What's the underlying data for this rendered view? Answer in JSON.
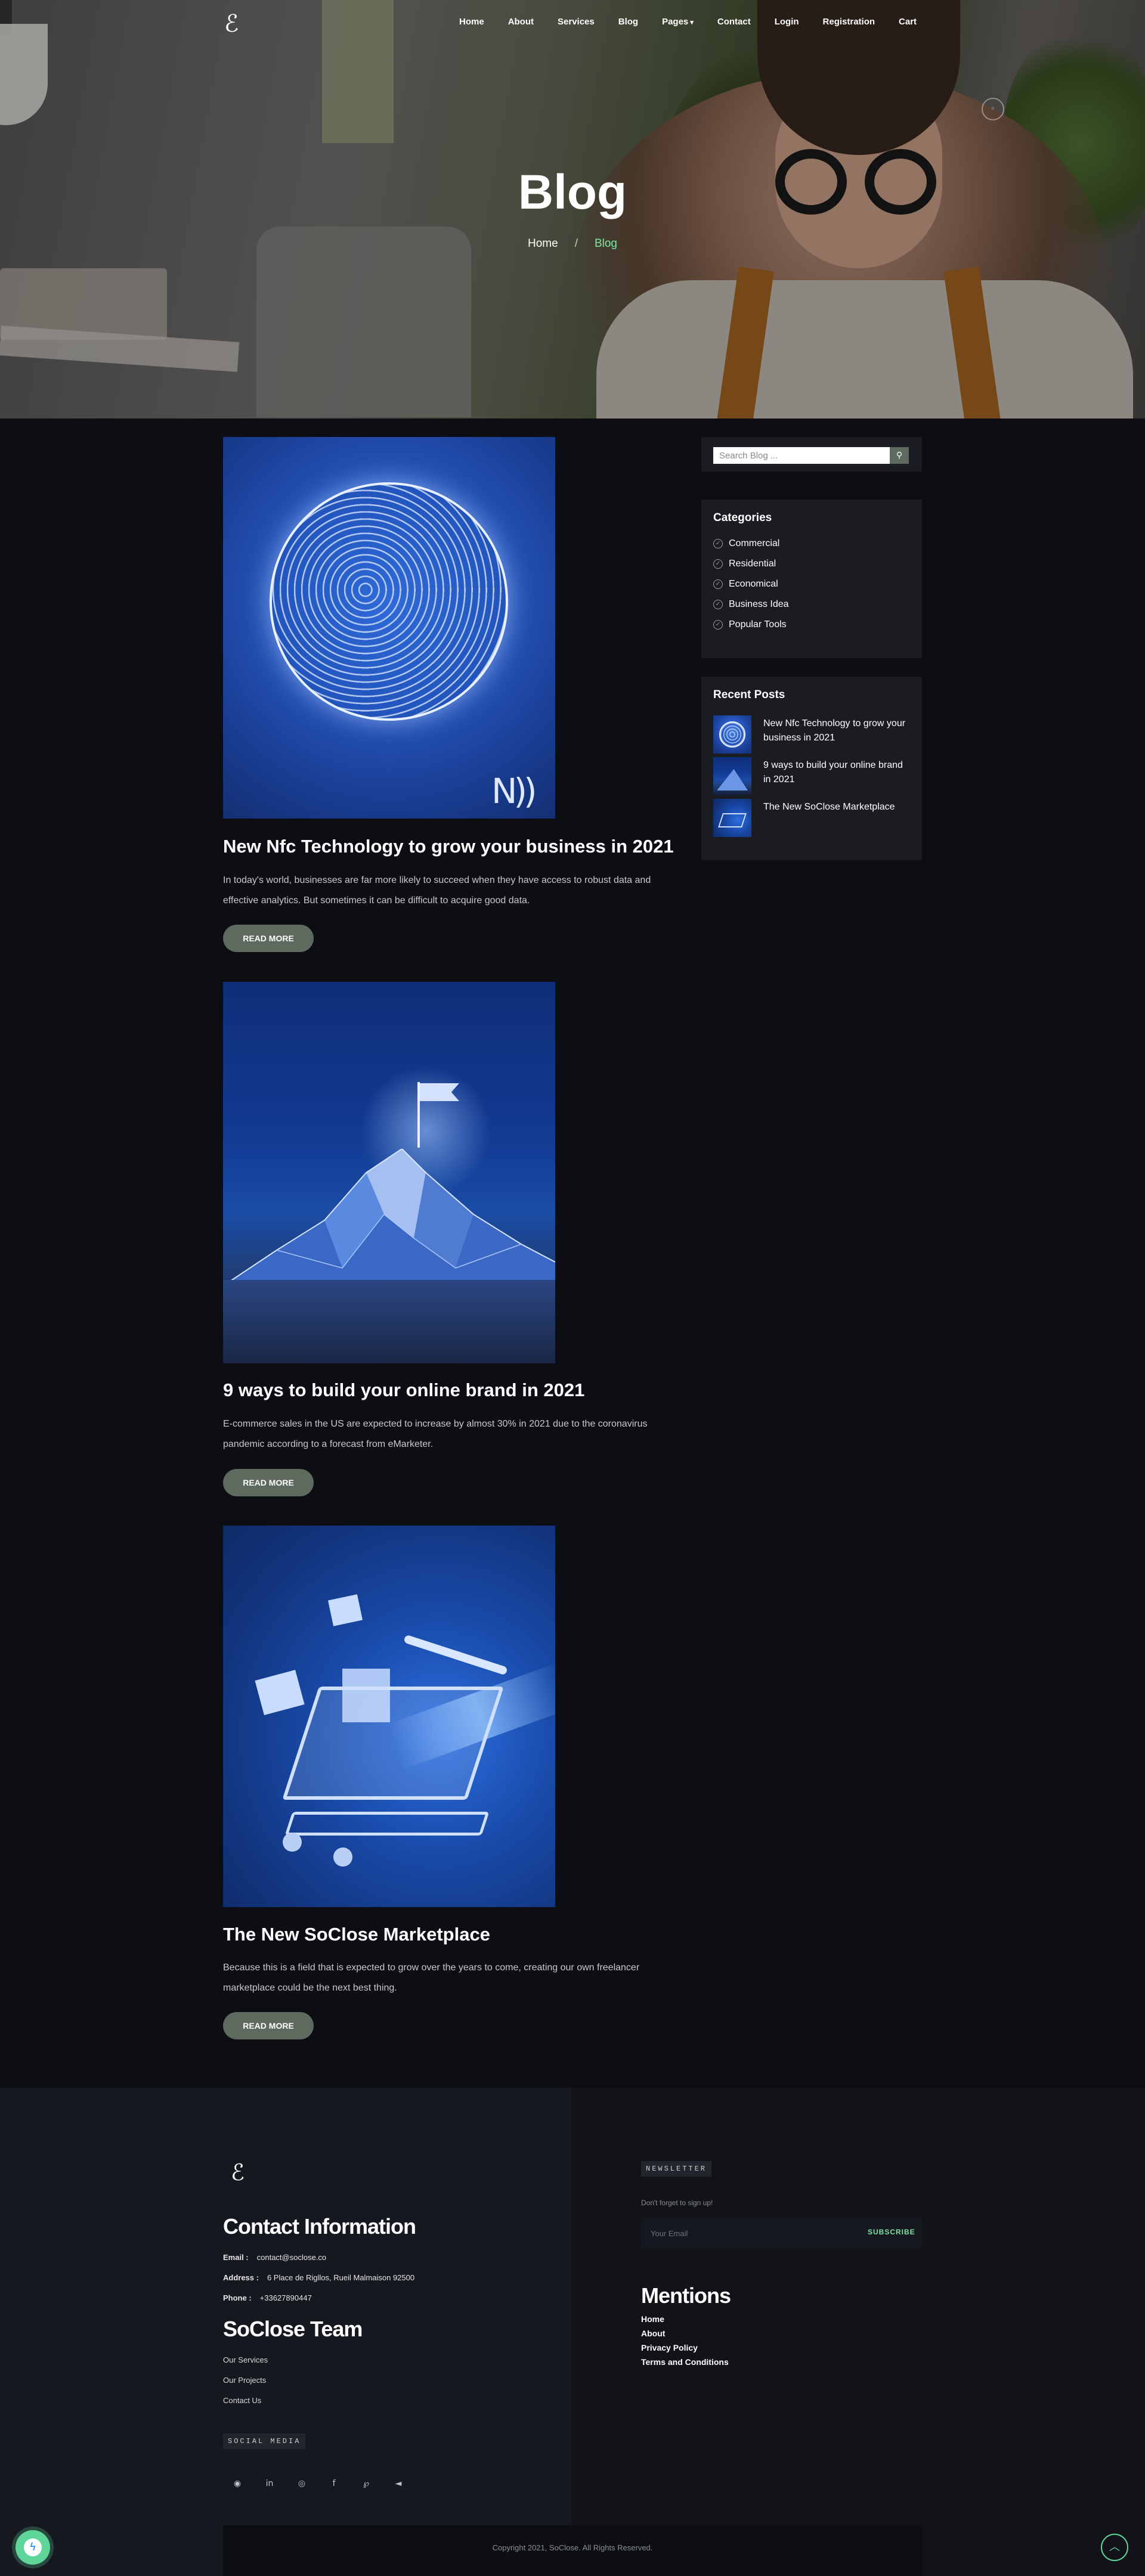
{
  "brand": {
    "logo_glyph": "ℰ"
  },
  "nav": {
    "items": [
      "Home",
      "About",
      "Services",
      "Blog",
      "Pages",
      "Contact",
      "Login",
      "Registration",
      "Cart"
    ]
  },
  "hero": {
    "title": "Blog",
    "breadcrumb": {
      "home": "Home",
      "separator": "/",
      "current": "Blog"
    }
  },
  "posts": [
    {
      "title": "New Nfc Technology to grow your business in 2021",
      "excerpt": "In today's world, businesses are far more likely to succeed when they have access to robust data and effective analytics. But sometimes it can be difficult to acquire good data.",
      "button": "READ MORE"
    },
    {
      "title": "9 ways to build your online brand in 2021",
      "excerpt": "E-commerce sales in the US are expected to increase by almost 30% in 2021 due to the coronavirus pandemic according to a forecast from eMarketer.",
      "button": "READ MORE"
    },
    {
      "title": "The New SoClose Marketplace",
      "excerpt": "Because this is a field that is expected to grow over the years to come, creating our own freelancer marketplace could be the next best thing.",
      "button": "READ MORE"
    }
  ],
  "sidebar": {
    "search_placeholder": "Search Blog ...",
    "categories_title": "Categories",
    "categories": [
      "Commercial",
      "Residential",
      "Economical",
      "Business Idea",
      "Popular Tools"
    ],
    "recent_title": "Recent Posts",
    "recent": [
      "New Nfc Technology to grow your business in 2021",
      "9 ways to build your online brand in 2021",
      "The New SoClose Marketplace"
    ]
  },
  "footer": {
    "contact_title": "Contact Information",
    "email_label": "Email :",
    "email": "contact@soclose.co",
    "address_label": "Address :",
    "address": "6 Place de Rigllos, Rueil Malmaison 92500",
    "phone_label": "Phone :",
    "phone": "+33627890447",
    "team_title": "SoClose Team",
    "team_links": [
      "Our Services",
      "Our Projects",
      "Contact Us"
    ],
    "social_tag": "SOCIAL MEDIA",
    "social_icons": [
      "github-icon",
      "linkedin-icon",
      "instagram-icon",
      "facebook-icon",
      "pinterest-icon",
      "telegram-icon"
    ],
    "newsletter_tag": "NEWSLETTER",
    "newsletter_note": "Don't forget to sign up!",
    "newsletter_placeholder": "Your Email",
    "newsletter_button": "SUBSCRIBE",
    "mentions_title": "Mentions",
    "mentions_links": [
      "Home",
      "About",
      "Privacy Policy",
      "Terms and Conditions"
    ],
    "copyright": "Copyright 2021, SoClose. All Rights Reserved."
  },
  "colors": {
    "accent": "#7ee5a3",
    "button": "#5d6a5d",
    "bg": "#0c0e13",
    "panel": "#1a1c22"
  }
}
